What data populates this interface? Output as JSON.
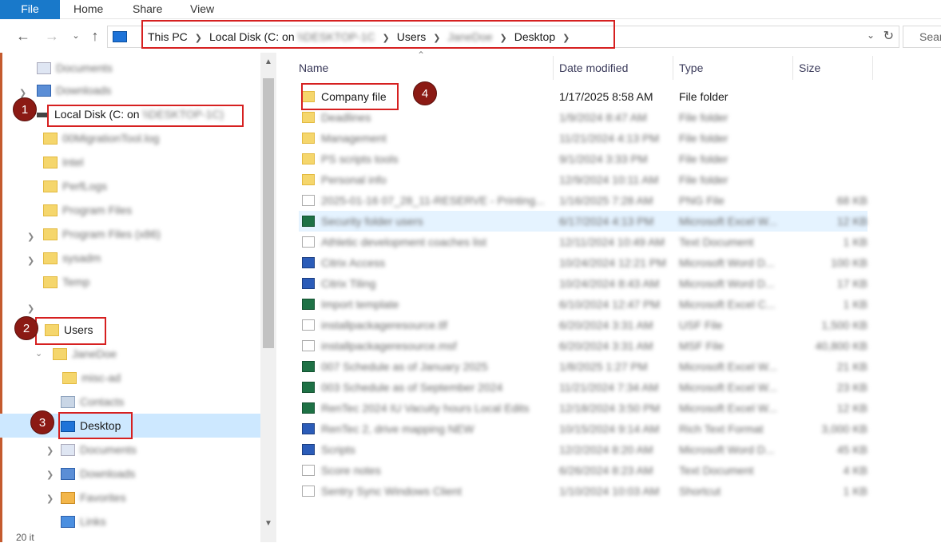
{
  "ribbon": {
    "tabs": [
      "File",
      "Home",
      "Share",
      "View"
    ]
  },
  "address": {
    "crumbs": [
      "This PC",
      "Local Disk (C: on",
      "Users",
      "",
      "Desktop"
    ],
    "blurred_part": "\\\\DESKTOP-1C",
    "blurred_user": "JaneDoe"
  },
  "search": {
    "placeholder": "Sear"
  },
  "nav": {
    "documents": "Documents",
    "downloads": "Downloads",
    "local_disk": "Local Disk (C: on",
    "local_disk_blur": "\\\\DESKTOP-1C)",
    "folders": [
      "00MigrationTool.log",
      "Intel",
      "PerfLogs",
      "Program Files",
      "Program Files (x86)",
      "sysadm",
      "Temp"
    ],
    "users": "Users",
    "user": "JaneDoe",
    "user_sub": "misc-ad",
    "contacts": "Contacts",
    "desktop": "Desktop",
    "after": [
      "Documents",
      "Downloads",
      "Favorites",
      "Links"
    ]
  },
  "badges": [
    "1",
    "2",
    "3",
    "4"
  ],
  "list": {
    "columns": {
      "name": "Name",
      "date": "Date modified",
      "type": "Type",
      "size": "Size"
    },
    "rows": [
      {
        "name": "Company file",
        "date": "1/17/2025 8:58 AM",
        "type": "File folder",
        "size": "",
        "icon": "folder",
        "clear": true
      },
      {
        "name": "Deadlines",
        "date": "1/9/2024 8:47 AM",
        "type": "File folder",
        "size": "",
        "icon": "folder"
      },
      {
        "name": "Management",
        "date": "11/21/2024 4:13 PM",
        "type": "File folder",
        "size": "",
        "icon": "folder"
      },
      {
        "name": "PS scripts tools",
        "date": "9/1/2024 3:33 PM",
        "type": "File folder",
        "size": "",
        "icon": "folder"
      },
      {
        "name": "Personal info",
        "date": "12/9/2024 10:11 AM",
        "type": "File folder",
        "size": "",
        "icon": "folder"
      },
      {
        "name": "2025-01-16 07_28_11-RESERVE - Printing...",
        "date": "1/16/2025 7:28 AM",
        "type": "PNG File",
        "size": "68 KB",
        "icon": "doc"
      },
      {
        "name": "Security folder users",
        "date": "6/17/2024 4:13 PM",
        "type": "Microsoft Excel W...",
        "size": "12 KB",
        "icon": "xls",
        "hover": true
      },
      {
        "name": "Athletic development coaches list",
        "date": "12/11/2024 10:49 AM",
        "type": "Text Document",
        "size": "1 KB",
        "icon": "doc"
      },
      {
        "name": "Citrix Access",
        "date": "10/24/2024 12:21 PM",
        "type": "Microsoft Word D...",
        "size": "100 KB",
        "icon": "word"
      },
      {
        "name": "Citrix Tiling",
        "date": "10/24/2024 8:43 AM",
        "type": "Microsoft Word D...",
        "size": "17 KB",
        "icon": "word"
      },
      {
        "name": "Import template",
        "date": "6/10/2024 12:47 PM",
        "type": "Microsoft Excel C...",
        "size": "1 KB",
        "icon": "xls"
      },
      {
        "name": "installpackageresource.tlf",
        "date": "6/20/2024 3:31 AM",
        "type": "USF File",
        "size": "1,500 KB",
        "icon": "doc"
      },
      {
        "name": "installpackageresource.msf",
        "date": "6/20/2024 3:31 AM",
        "type": "MSF File",
        "size": "40,800 KB",
        "icon": "doc"
      },
      {
        "name": "007 Schedule as of January 2025",
        "date": "1/8/2025 1:27 PM",
        "type": "Microsoft Excel W...",
        "size": "21 KB",
        "icon": "xls"
      },
      {
        "name": "003 Schedule as of September 2024",
        "date": "11/21/2024 7:34 AM",
        "type": "Microsoft Excel W...",
        "size": "23 KB",
        "icon": "xls"
      },
      {
        "name": "RenTec 2024 IU Vacuity hours Local Edits",
        "date": "12/18/2024 3:50 PM",
        "type": "Microsoft Excel W...",
        "size": "12 KB",
        "icon": "xls"
      },
      {
        "name": "RenTec 2, drive mapping NEW",
        "date": "10/15/2024 9:14 AM",
        "type": "Rich Text Format",
        "size": "3,000 KB",
        "icon": "word"
      },
      {
        "name": "Scripts",
        "date": "12/2/2024 8:20 AM",
        "type": "Microsoft Word D...",
        "size": "45 KB",
        "icon": "word"
      },
      {
        "name": "Score notes",
        "date": "6/26/2024 8:23 AM",
        "type": "Text Document",
        "size": "4 KB",
        "icon": "doc"
      },
      {
        "name": "Sentry Sync Windows Client",
        "date": "1/10/2024 10:03 AM",
        "type": "Shortcut",
        "size": "1 KB",
        "icon": "doc"
      }
    ]
  },
  "status": "20 it"
}
